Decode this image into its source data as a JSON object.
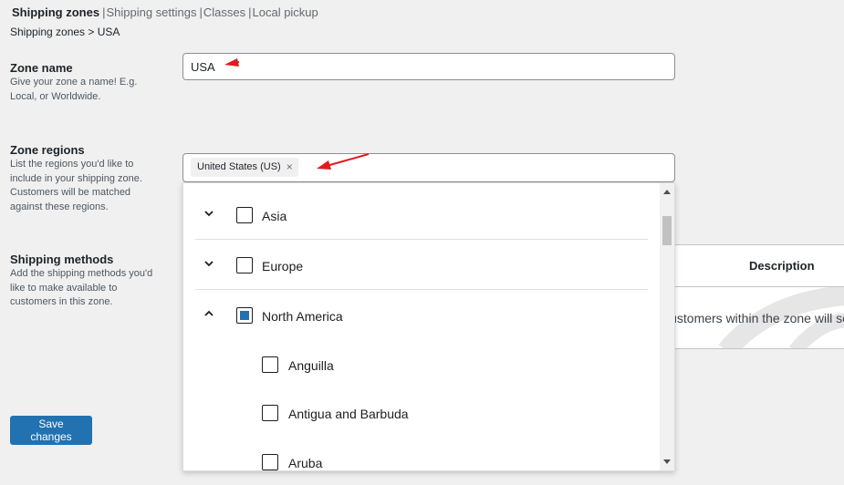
{
  "subnav": {
    "items": [
      {
        "label": "Shipping zones",
        "current": true
      },
      {
        "label": "Shipping settings"
      },
      {
        "label": "Classes"
      },
      {
        "label": "Local pickup"
      }
    ],
    "separator": "|"
  },
  "breadcrumb": "Shipping zones > USA",
  "zone_name": {
    "title": "Zone name",
    "description": "Give your zone a name! E.g. Local, or Worldwide.",
    "value": "USA"
  },
  "zone_regions": {
    "title": "Zone regions",
    "description": "List the regions you'd like to include in your shipping zone. Customers will be matched against these regions.",
    "selected_token": "United States (US)",
    "remove_glyph": "×"
  },
  "dropdown": {
    "options": [
      {
        "label": "Asia",
        "level": 0,
        "expanded": false,
        "state": "unchecked"
      },
      {
        "label": "Europe",
        "level": 0,
        "expanded": false,
        "state": "unchecked"
      },
      {
        "label": "North America",
        "level": 0,
        "expanded": true,
        "state": "partial"
      },
      {
        "label": "Anguilla",
        "level": 1,
        "state": "unchecked"
      },
      {
        "label": "Antigua and Barbuda",
        "level": 1,
        "state": "unchecked"
      },
      {
        "label": "Aruba",
        "level": 1,
        "state": "unchecked"
      }
    ]
  },
  "shipping_methods": {
    "title": "Shipping methods",
    "description": "Add the shipping methods you'd like to make available to customers in this zone.",
    "column_description": "Description",
    "empty_message": "Customers within the zone will see them."
  },
  "save_button": "Save changes",
  "colors": {
    "primary": "#2271b1",
    "annotation_arrow": "#e21b1b",
    "background": "#f0f0f1"
  }
}
